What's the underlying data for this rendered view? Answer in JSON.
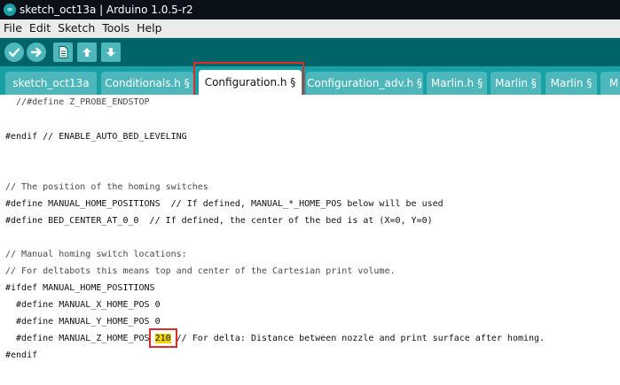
{
  "window": {
    "title": "sketch_oct13a | Arduino 1.0.5-r2",
    "logo_glyph": "∞"
  },
  "menu": {
    "items": [
      "File",
      "Edit",
      "Sketch",
      "Tools",
      "Help"
    ]
  },
  "toolbar": {
    "buttons": [
      "verify-icon",
      "upload-icon",
      "new-icon",
      "open-icon",
      "save-icon"
    ]
  },
  "tabs": [
    {
      "label": "sketch_oct13a",
      "active": false
    },
    {
      "label": "Conditionals.h §",
      "active": false
    },
    {
      "label": "Configuration.h §",
      "active": true
    },
    {
      "label": "Configuration_adv.h §",
      "active": false
    },
    {
      "label": "Marlin.h §",
      "active": false
    },
    {
      "label": "Marlin §",
      "active": false
    },
    {
      "label": "Marlin §",
      "active": false
    },
    {
      "label": "M",
      "active": false
    }
  ],
  "code": {
    "line1": "  //#define Z_PROBE_ENDSTOP",
    "line2": "#endif // ENABLE_AUTO_BED_LEVELING",
    "line3": "// The position of the homing switches",
    "line4": "#define MANUAL_HOME_POSITIONS  // If defined, MANUAL_*_HOME_POS below will be used",
    "line5": "#define BED_CENTER_AT_0_0  // If defined, the center of the bed is at (X=0, Y=0)",
    "line6": "// Manual homing switch locations:",
    "line7": "// For deltabots this means top and center of the Cartesian print volume.",
    "line8": "#ifdef MANUAL_HOME_POSITIONS",
    "line9": "  #define MANUAL_X_HOME_POS 0",
    "line10": "  #define MANUAL_Y_HOME_POS 0",
    "line11_prefix": "  #define MANUAL_Z_HOME_POS ",
    "line11_value": "210",
    "line11_suffix": " // For delta: Distance between nozzle and print surface after homing.",
    "line12": "#endif"
  },
  "colors": {
    "title_bg": "#0b1119",
    "toolbar_bg": "#006468",
    "tabs_bg": "#17a1a5",
    "tab_bg": "#4db7bb",
    "highlight_red": "#e02b2b",
    "value_highlight": "#f2d600"
  }
}
